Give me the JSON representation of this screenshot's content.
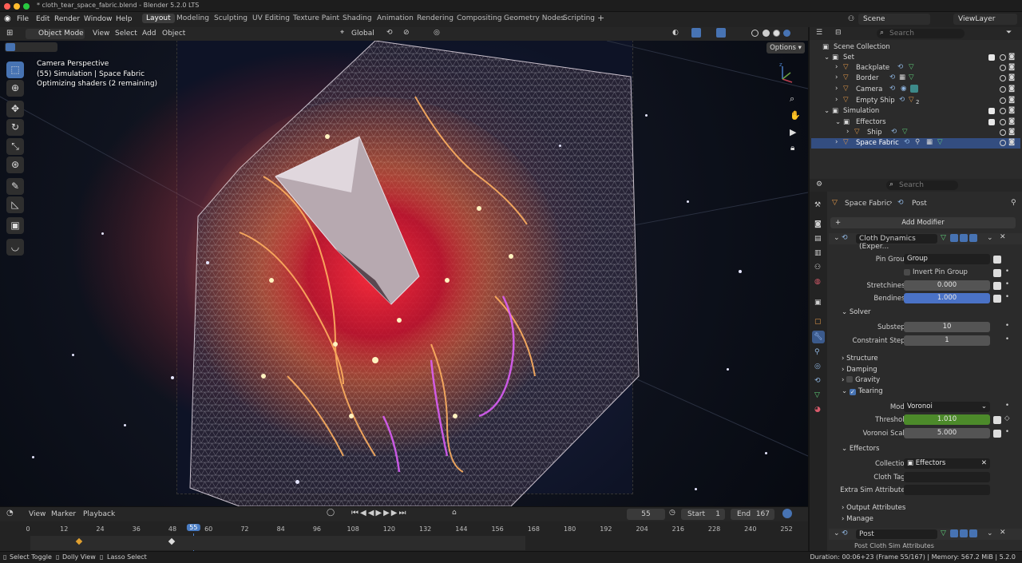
{
  "window": {
    "title": "* cloth_tear_space_fabric.blend - Blender 5.2.0 LTS"
  },
  "menu": [
    "File",
    "Edit",
    "Render",
    "Window",
    "Help"
  ],
  "workspaces": [
    "Layout",
    "Modeling",
    "Sculpting",
    "UV Editing",
    "Texture Paint",
    "Shading",
    "Animation",
    "Rendering",
    "Compositing",
    "Geometry Nodes",
    "Scripting"
  ],
  "workspace_add": "+",
  "scene": {
    "scene": "Scene",
    "view_layer": "ViewLayer"
  },
  "viewport_header": {
    "mode": "Object Mode",
    "items": [
      "View",
      "Select",
      "Add",
      "Object"
    ],
    "orientation": "Global",
    "options": "Options"
  },
  "viewport_info": {
    "line1": "Camera Perspective",
    "line2": "(55) Simulation | Space Fabric",
    "line3": "Optimizing shaders (2 remaining)"
  },
  "outliner": {
    "search_placeholder": "Search",
    "root": "Scene Collection",
    "rows": [
      {
        "label": "Set"
      },
      {
        "label": "Backplate"
      },
      {
        "label": "Border"
      },
      {
        "label": "Camera"
      },
      {
        "label": "Empty Ship",
        "badge": "2"
      },
      {
        "label": "Simulation"
      },
      {
        "label": "Effectors"
      },
      {
        "label": "Ship"
      },
      {
        "label": "Space Fabric"
      }
    ]
  },
  "properties": {
    "search_placeholder": "Search",
    "breadcrumb": [
      "Space Fabric",
      "Post"
    ],
    "add_modifier": "Add Modifier",
    "modifier_name": "Cloth Dynamics (Exper...",
    "pin_group": {
      "label": "Pin Group",
      "value": "Group"
    },
    "invert_pin": "Invert Pin Group",
    "stretchiness": {
      "label": "Stretchiness",
      "value": "0.000"
    },
    "bendiness": {
      "label": "Bendiness",
      "value": "1.000"
    },
    "solver": "Solver",
    "substeps": {
      "label": "Substeps",
      "value": "10"
    },
    "constraint_steps": {
      "label": "Constraint Steps",
      "value": "1"
    },
    "structure": "Structure",
    "damping": "Damping",
    "gravity": "Gravity",
    "tearing": "Tearing",
    "mode": {
      "label": "Mode",
      "value": "Voronoi"
    },
    "threshold": {
      "label": "Threshold",
      "value": "1.010"
    },
    "voronoi_scale": {
      "label": "Voronoi Scale",
      "value": "5.000"
    },
    "effectors": "Effectors",
    "collection": {
      "label": "Collection",
      "value": "Effectors"
    },
    "cloth_tags": "Cloth Tags",
    "extra_attr": "Extra Sim Attributes",
    "output_attr": "Output Attributes",
    "manage": "Manage",
    "post_name": "Post",
    "post_sub": "Post Cloth Sim Attributes"
  },
  "timeline": {
    "menus": [
      "View",
      "Marker",
      "Playback"
    ],
    "frame": "55",
    "start_label": "Start",
    "start": "1",
    "end_label": "End",
    "end": "167",
    "ticks": [
      "0",
      "12",
      "24",
      "36",
      "48",
      "55",
      "60",
      "72",
      "84",
      "96",
      "108",
      "120",
      "132",
      "144",
      "156",
      "168",
      "180",
      "192",
      "204",
      "216",
      "228",
      "240",
      "252"
    ]
  },
  "status": {
    "left": [
      "Select Toggle",
      "Dolly View",
      "Lasso Select"
    ],
    "right": "Duration: 00:06+23 (Frame 55/167) | Memory: 567.2 MiB | 5.2.0"
  },
  "colors": {
    "accent": "#4773b3",
    "selected_row": "#334d80",
    "threshold": "#4c8a2a",
    "bendiness": "#4a72c6",
    "frame_marker": "#4a7dc4"
  }
}
